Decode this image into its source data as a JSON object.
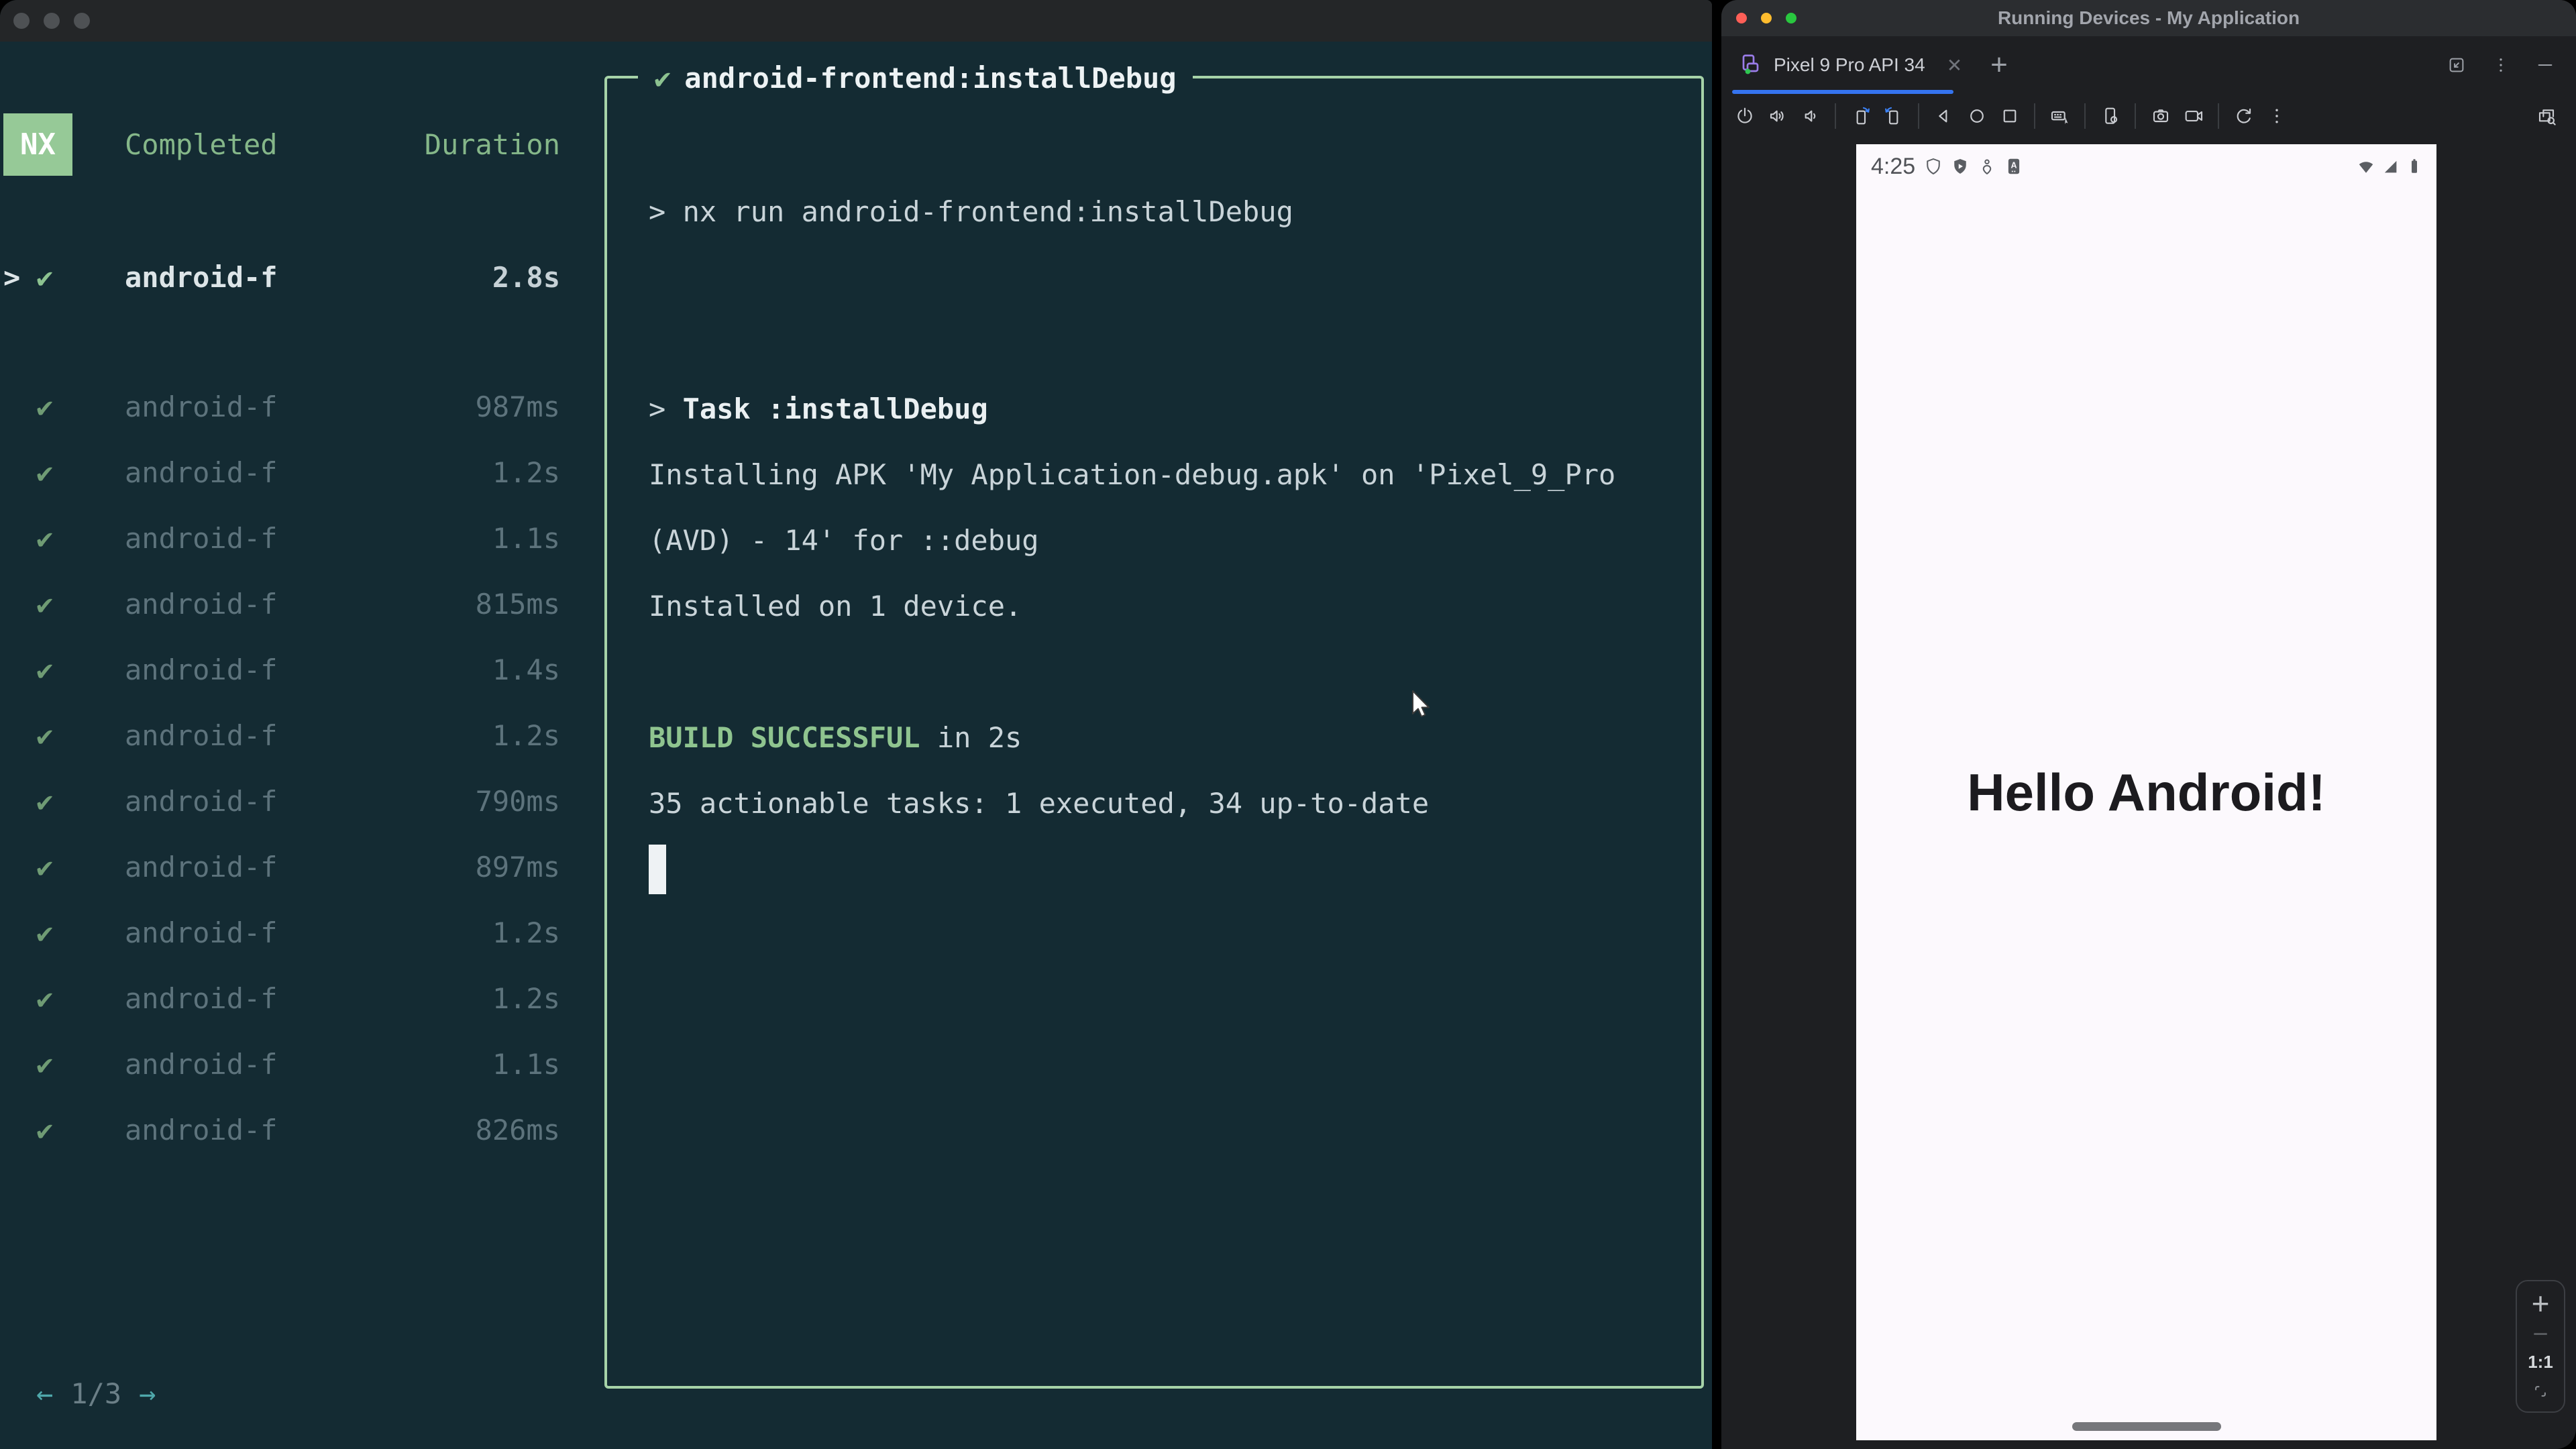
{
  "colors": {
    "terminal_bg": "#142b33",
    "terminal_green": "#85b789",
    "box_border": "#a6d3a8",
    "nx_badge_bg": "#96c997",
    "success_green": "#8fc48f",
    "teal_accent": "#4fa8ab",
    "ide_bg": "#1e1f22",
    "ide_titlebar": "#2b2d30",
    "tab_underline_blue": "#3574f0",
    "phone_screen_bg": "#fcf9fd",
    "hello_text_color": "#1c1b1f"
  },
  "left_window": {
    "sidebar": {
      "logo_text": "NX",
      "header": {
        "completed": "Completed",
        "duration": "Duration"
      },
      "selected_task": {
        "chevron": ">",
        "check": "✔",
        "name": "android-f",
        "duration": "2.8s"
      },
      "tasks": [
        {
          "check": "✔",
          "name": "android-f",
          "duration": "987ms"
        },
        {
          "check": "✔",
          "name": "android-f",
          "duration": "1.2s"
        },
        {
          "check": "✔",
          "name": "android-f",
          "duration": "1.1s"
        },
        {
          "check": "✔",
          "name": "android-f",
          "duration": "815ms"
        },
        {
          "check": "✔",
          "name": "android-f",
          "duration": "1.4s"
        },
        {
          "check": "✔",
          "name": "android-f",
          "duration": "1.2s"
        },
        {
          "check": "✔",
          "name": "android-f",
          "duration": "790ms"
        },
        {
          "check": "✔",
          "name": "android-f",
          "duration": "897ms"
        },
        {
          "check": "✔",
          "name": "android-f",
          "duration": "1.2s"
        },
        {
          "check": "✔",
          "name": "android-f",
          "duration": "1.2s"
        },
        {
          "check": "✔",
          "name": "android-f",
          "duration": "1.1s"
        },
        {
          "check": "✔",
          "name": "android-f",
          "duration": "826ms"
        }
      ],
      "pagination": {
        "prev": "←",
        "label": "1/3",
        "next": "→"
      }
    },
    "output_panel": {
      "title_check": "✔",
      "title": "android-frontend:installDebug",
      "lines": [
        {
          "parts": [
            {
              "t": "> nx run android-frontend:installDebug",
              "s": "plain"
            }
          ]
        },
        {
          "parts": []
        },
        {
          "parts": []
        },
        {
          "parts": [
            {
              "t": "> ",
              "s": "plain"
            },
            {
              "t": "Task :installDebug",
              "s": "bold"
            }
          ]
        },
        {
          "parts": [
            {
              "t": "Installing APK 'My Application-debug.apk' on 'Pixel_9_Pro",
              "s": "plain"
            }
          ]
        },
        {
          "parts": [
            {
              "t": "(AVD) - 14' for ::debug",
              "s": "plain"
            }
          ]
        },
        {
          "parts": [
            {
              "t": "Installed on 1 device.",
              "s": "plain"
            }
          ]
        },
        {
          "parts": []
        },
        {
          "parts": [
            {
              "t": "BUILD SUCCESSFUL",
              "s": "green"
            },
            {
              "t": " in 2s",
              "s": "plain"
            }
          ]
        },
        {
          "parts": [
            {
              "t": "35 actionable tasks: 1 executed, 34 up-to-date",
              "s": "plain"
            }
          ]
        },
        {
          "parts": [],
          "cursor": true
        }
      ]
    }
  },
  "right_window": {
    "titlebar": {
      "title": "Running Devices - My Application"
    },
    "tab_bar": {
      "active_tab": {
        "icon": "device-phone-icon",
        "label": "Pixel 9 Pro API 34",
        "close": "✕"
      },
      "new_tab_label": "+",
      "window_controls": [
        "dock-window-icon",
        "more-vertical-icon",
        "hide-window-icon"
      ]
    },
    "toolbar": {
      "groups": [
        [
          "power-icon",
          "volume-up-icon",
          "volume-down-icon"
        ],
        [
          "rotate-left-icon",
          "rotate-right-icon"
        ],
        [
          "back-icon",
          "home-icon",
          "overview-icon"
        ],
        [
          "keyboard-input-icon"
        ],
        [
          "device-settings-icon"
        ],
        [
          "screenshot-icon",
          "screen-record-icon"
        ],
        [
          "restart-icon",
          "more-options-icon"
        ]
      ],
      "right_icon": "layout-inspect-icon"
    },
    "emulator": {
      "status_bar": {
        "time": "4:25",
        "left_icons": [
          "privacy-shield-icon",
          "play-protect-icon",
          "profile-pin-icon",
          "app-badge-icon"
        ],
        "right_icons": [
          "wifi-icon",
          "signal-icon",
          "battery-icon"
        ]
      },
      "screen_text": "Hello Android!",
      "zoom_controls": {
        "zoom_in": "+",
        "zoom_out": "−",
        "actual_size": "1:1",
        "fit": "fit-screen-icon"
      }
    }
  }
}
